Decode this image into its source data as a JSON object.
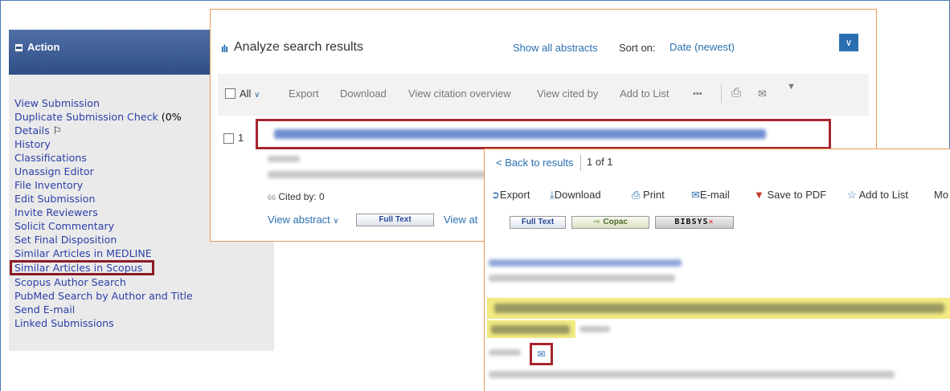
{
  "action_panel": {
    "header": "Action",
    "items": [
      {
        "label": "View Submission"
      },
      {
        "label": "Duplicate Submission Check",
        "suffix": " (0%"
      },
      {
        "label": "Details",
        "suffix": " ⚐"
      },
      {
        "label": "History"
      },
      {
        "label": "Classifications"
      },
      {
        "label": "Unassign Editor"
      },
      {
        "label": "File Inventory"
      },
      {
        "label": "Edit Submission"
      },
      {
        "label": "Invite Reviewers"
      },
      {
        "label": "Solicit Commentary"
      },
      {
        "label": "Set Final Disposition"
      },
      {
        "label": "Similar Articles in MEDLINE"
      },
      {
        "label": "Similar Articles in Scopus",
        "highlighted": true
      },
      {
        "label": "Scopus Author Search"
      },
      {
        "label": "PubMed Search by Author and Title"
      },
      {
        "label": "Send E-mail"
      },
      {
        "label": "Linked Submissions"
      }
    ]
  },
  "results": {
    "title_icon": "bar-chart-icon",
    "title": "Analyze search results",
    "show_all_abstracts": "Show all abstracts",
    "sort_label": "Sort on:",
    "sort_value": "Date (newest)",
    "toolbar": {
      "all": "All",
      "export": "Export",
      "download": "Download",
      "view_citation_overview": "View citation overview",
      "view_cited_by": "View cited by",
      "add_to_list": "Add to List",
      "more": "•••"
    },
    "row": {
      "number": "1",
      "cited_by": "Cited by: 0",
      "view_abstract": "View abstract",
      "full_text": "Full Text",
      "view_at": "View at"
    }
  },
  "detail": {
    "back": "Back to results",
    "pager": "1 of 1",
    "actions": {
      "export": "Export",
      "download": "Download",
      "print": "Print",
      "email": "E-mail",
      "save_pdf": "Save to PDF",
      "add_to_list": "Add to List",
      "more": "Mo"
    },
    "sources": {
      "full_text": "Full Text",
      "copac": "Copac",
      "third": "BIBSYS"
    }
  },
  "colors": {
    "link_blue": "#2a6fb0",
    "action_link": "#2b3fa8",
    "highlight_red": "#a8242e",
    "panel_border": "#e89b57",
    "header_blue": "#2f4e86"
  }
}
